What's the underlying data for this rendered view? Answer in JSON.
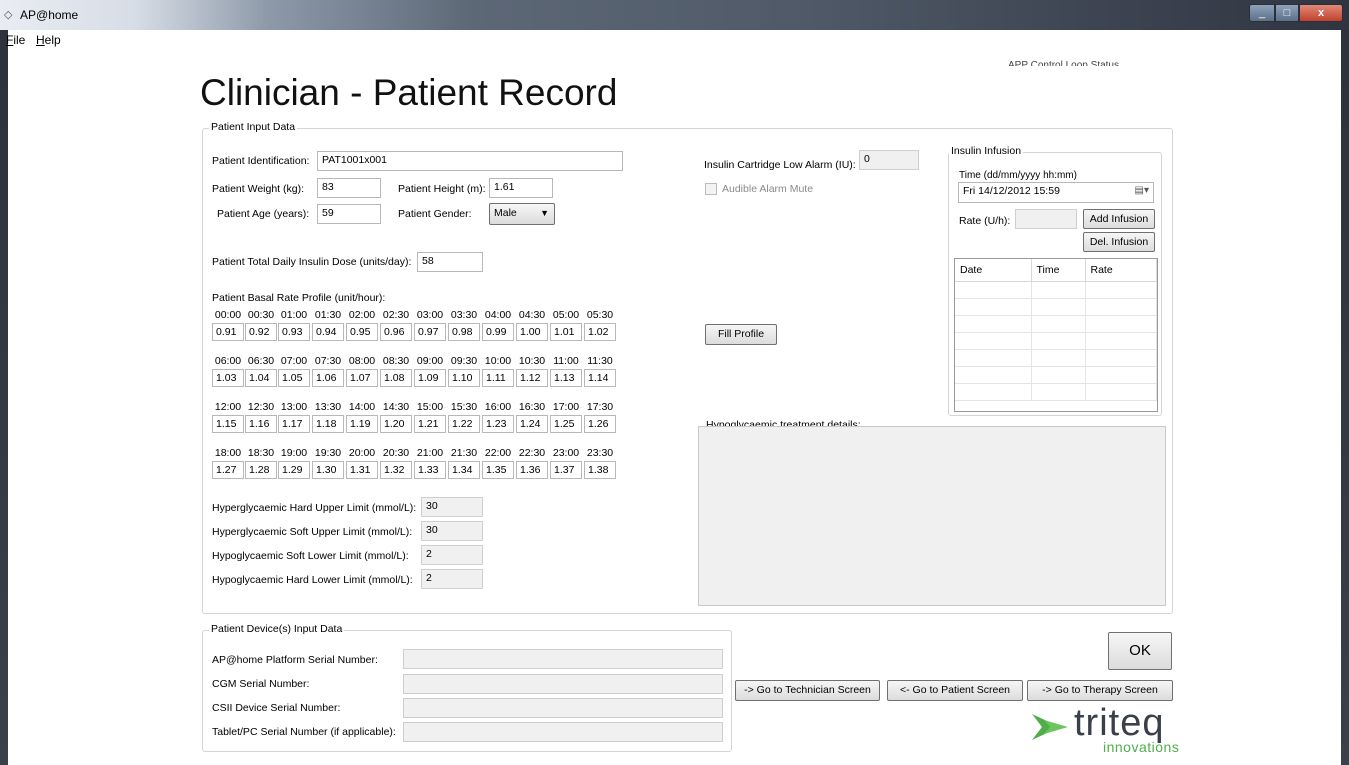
{
  "window": {
    "title": "AP@home",
    "close_glyph": "x"
  },
  "menu": [
    {
      "label": "File",
      "accel": "F"
    },
    {
      "label": "Help",
      "accel": "H"
    }
  ],
  "page_title": "Clinician - Patient Record",
  "status_top": "APP Control Loop Status",
  "patient_input": {
    "legend": "Patient Input Data",
    "identification": {
      "label": "Patient Identification:",
      "value": "PAT1001x001"
    },
    "weight": {
      "label": "Patient Weight (kg):",
      "value": "83"
    },
    "height": {
      "label": "Patient Height (m):",
      "value": "1.61"
    },
    "age": {
      "label": "Patient Age (years):",
      "value": "59"
    },
    "gender": {
      "label": "Patient Gender:",
      "value": "Male"
    },
    "tdd": {
      "label": "Patient Total Daily Insulin Dose (units/day):",
      "value": "58"
    },
    "basal_label": "Patient Basal Rate Profile (unit/hour):",
    "basal_rows": [
      {
        "times": [
          "00:00",
          "00:30",
          "01:00",
          "01:30",
          "02:00",
          "02:30",
          "03:00",
          "03:30",
          "04:00",
          "04:30",
          "05:00",
          "05:30"
        ],
        "rates": [
          "0.91",
          "0.92",
          "0.93",
          "0.94",
          "0.95",
          "0.96",
          "0.97",
          "0.98",
          "0.99",
          "1.00",
          "1.01",
          "1.02"
        ]
      },
      {
        "times": [
          "06:00",
          "06:30",
          "07:00",
          "07:30",
          "08:00",
          "08:30",
          "09:00",
          "09:30",
          "10:00",
          "10:30",
          "11:00",
          "11:30"
        ],
        "rates": [
          "1.03",
          "1.04",
          "1.05",
          "1.06",
          "1.07",
          "1.08",
          "1.09",
          "1.10",
          "1.11",
          "1.12",
          "1.13",
          "1.14"
        ]
      },
      {
        "times": [
          "12:00",
          "12:30",
          "13:00",
          "13:30",
          "14:00",
          "14:30",
          "15:00",
          "15:30",
          "16:00",
          "16:30",
          "17:00",
          "17:30"
        ],
        "rates": [
          "1.15",
          "1.16",
          "1.17",
          "1.18",
          "1.19",
          "1.20",
          "1.21",
          "1.22",
          "1.23",
          "1.24",
          "1.25",
          "1.26"
        ]
      },
      {
        "times": [
          "18:00",
          "18:30",
          "19:00",
          "19:30",
          "20:00",
          "20:30",
          "21:00",
          "21:30",
          "22:00",
          "22:30",
          "23:00",
          "23:30"
        ],
        "rates": [
          "1.27",
          "1.28",
          "1.29",
          "1.30",
          "1.31",
          "1.32",
          "1.33",
          "1.34",
          "1.35",
          "1.36",
          "1.37",
          "1.38"
        ]
      }
    ],
    "limits": [
      {
        "label": "Hyperglycaemic Hard Upper Limit (mmol/L):",
        "value": "30"
      },
      {
        "label": "Hyperglycaemic Soft Upper Limit (mmol/L):",
        "value": "30"
      },
      {
        "label": "Hypoglycaemic Soft Lower Limit (mmol/L):",
        "value": "2"
      },
      {
        "label": "Hypoglycaemic Hard Lower Limit (mmol/L):",
        "value": "2"
      }
    ],
    "cartridge_alarm": {
      "label": "Insulin Cartridge Low Alarm (IU):",
      "value": "0"
    },
    "audible_mute": {
      "label": "Audible Alarm Mute",
      "checked": false
    },
    "fill_profile": "Fill Profile",
    "hypo_details_label": "Hypoglycaemic treatment details:"
  },
  "infusion": {
    "legend": "Insulin Infusion",
    "time_label": "Time (dd/mm/yyyy hh:mm)",
    "time_value": "Fri   14/12/2012  15:59",
    "rate_label": "Rate (U/h):",
    "rate_value": "",
    "add_button": "Add Infusion",
    "del_button": "Del. Infusion",
    "columns": [
      "Date",
      "Time",
      "Rate"
    ]
  },
  "devices": {
    "legend": "Patient Device(s) Input Data",
    "fields": [
      {
        "label": "AP@home Platform Serial Number:",
        "value": ""
      },
      {
        "label": "CGM Serial Number:",
        "value": ""
      },
      {
        "label": "CSII Device Serial Number:",
        "value": ""
      },
      {
        "label": "Tablet/PC Serial Number (if applicable):",
        "value": ""
      }
    ]
  },
  "buttons": {
    "ok": "OK",
    "technician": "-> Go to Technician Screen",
    "patient": "<- Go to Patient Screen",
    "therapy": "-> Go to Therapy Screen"
  },
  "logo": {
    "word": "triteq",
    "sub": "innovations",
    "mark_color": "#4fae4a"
  },
  "icons": {
    "app": "app-icon",
    "dropdown": "chevron-down-icon",
    "calendar": "calendar-icon"
  }
}
